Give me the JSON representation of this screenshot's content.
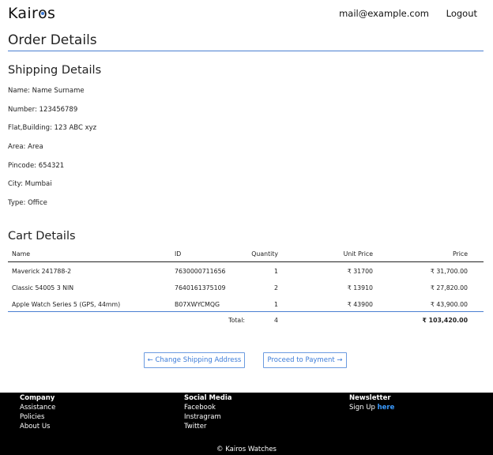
{
  "header": {
    "logo_text": "Kairos",
    "email": "mail@example.com",
    "logout_label": "Logout",
    "accent_color": "#3b7bd8"
  },
  "page_title": "Order Details",
  "shipping": {
    "title": "Shipping Details",
    "lines": [
      "Name: Name Surname",
      "Number: 123456789",
      "Flat,Building: 123 ABC xyz",
      "Area: Area",
      "Pincode: 654321",
      "City: Mumbai",
      "Type: Office"
    ]
  },
  "cart": {
    "title": "Cart Details",
    "columns": [
      "Name",
      "ID",
      "Quantity",
      "Unit Price",
      "Price"
    ],
    "rows": [
      {
        "name": "Maverick 241788-2",
        "id": "7630000711656",
        "qty": "1",
        "unit": "₹ 31700",
        "price": "₹ 31,700.00"
      },
      {
        "name": "Classic 54005 3 NIN",
        "id": "7640161375109",
        "qty": "2",
        "unit": "₹ 13910",
        "price": "₹ 27,820.00"
      },
      {
        "name": "Apple Watch Series 5 (GPS, 44mm)",
        "id": "B07XWYCMQG",
        "qty": "1",
        "unit": "₹ 43900",
        "price": "₹ 43,900.00"
      }
    ],
    "total_label": "Total:",
    "total_qty": "4",
    "total_price": "₹ 103,420.00"
  },
  "actions": {
    "change_address": "←  Change Shipping Address",
    "proceed_payment": "Proceed to Payment  →"
  },
  "footer": {
    "company": {
      "heading": "Company",
      "links": [
        "Assistance",
        "Policies",
        "About Us"
      ]
    },
    "social": {
      "heading": "Social Media",
      "links": [
        "Facebook",
        "Instragram",
        "Twitter"
      ]
    },
    "newsletter": {
      "heading": "Newsletter",
      "text": "Sign Up ",
      "link": "here"
    },
    "copyright": "© Kairos Watches"
  }
}
